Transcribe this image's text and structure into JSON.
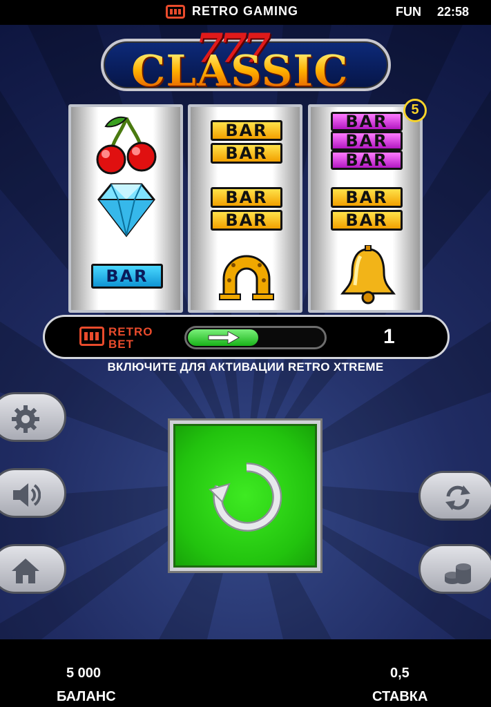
{
  "header": {
    "brand": "RETRO GAMING",
    "mode": "FUN",
    "time": "22:58"
  },
  "logo": {
    "number": "777",
    "title": "CLASSIC"
  },
  "reels": [
    {
      "symbols": [
        "cherry-icon",
        "diamond-icon",
        "bar-blue"
      ]
    },
    {
      "symbols": [
        "double-bar",
        "double-bar",
        "horseshoe-icon"
      ]
    },
    {
      "symbols": [
        "triple-bar",
        "double-bar",
        "bell-icon"
      ]
    }
  ],
  "bar_label": "BAR",
  "win_badge": "5",
  "retro_bet": {
    "logo_line1": "RETRO",
    "logo_line2": "BET",
    "count": "1",
    "toggle_on": false
  },
  "activate_text": "ВКЛЮЧИТЕ ДЛЯ АКТИВАЦИИ RETRO XTREME",
  "controls": {
    "left": [
      "gear-icon",
      "speaker-icon",
      "home-icon"
    ],
    "right": [
      "autoplay-icon",
      "coins-icon"
    ],
    "spin": "spin-icon"
  },
  "colors": {
    "spin_green": "#2bd314",
    "accent_red": "#e94b2c",
    "bg_blue": "#202c63"
  },
  "footer": {
    "balance_value": "5 000",
    "balance_label": "БАЛАНС",
    "stake_value": "0,5",
    "stake_label": "СТАВКА"
  }
}
